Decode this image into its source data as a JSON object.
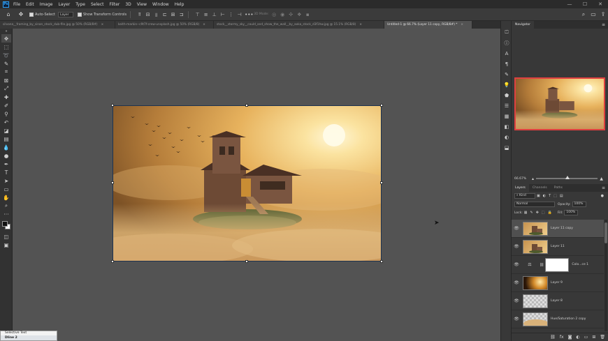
{
  "menubar": {
    "items": [
      "File",
      "Edit",
      "Image",
      "Layer",
      "Type",
      "Select",
      "Filter",
      "3D",
      "View",
      "Window",
      "Help"
    ]
  },
  "options": {
    "auto_select": "Auto-Select",
    "target": "Layer",
    "transform_controls": "Show Transform Controls",
    "mode_3d": "3D Mode:"
  },
  "tabs": [
    {
      "label": "silvana__framing_by_sinan_stock_dub-file.jpg @ 50% (RGB/8#)",
      "active": false
    },
    {
      "label": "keith-markin--c9t7f-crew-unsplash.jpg @ 50% (RGB/8)",
      "active": false
    },
    {
      "label": "stock__stormy_sky__could_and_show_the_wall__by_aoka_stock_d3f1hw.jpg @ 15.1% (RGB/8)",
      "active": false
    },
    {
      "label": "Untitled-1 @ 66.7% (Layer 11 copy, RGB/8#) *",
      "active": true
    }
  ],
  "navigator": {
    "title": "Navigator",
    "zoom": "66.67%"
  },
  "layers_panel": {
    "tabs": [
      "Layers",
      "Channels",
      "Paths"
    ],
    "kind_label": "Kind",
    "blend_mode": "Normal",
    "opacity_label": "Opacity:",
    "opacity_value": "100%",
    "lock_label": "Lock:",
    "fill_label": "Fill:",
    "fill_value": "100%",
    "layers": [
      {
        "name": "Layer 11 copy",
        "thumb": "scene",
        "selected": true
      },
      {
        "name": "Layer 11",
        "thumb": "scene",
        "selected": false
      },
      {
        "name": "Colo...ce 1",
        "thumb": "adjustment",
        "selected": false
      },
      {
        "name": "Layer 9",
        "thumb": "sun",
        "selected": false
      },
      {
        "name": "Layer 8",
        "thumb": "transparent",
        "selected": false
      },
      {
        "name": "Hue/Saturation 2 copy",
        "thumb": "clouds",
        "selected": false
      }
    ]
  },
  "taskbar": {
    "item1": "Selective Text",
    "item2": "Dline 2"
  },
  "colors": {
    "nav_frame": "#e04040",
    "accent": "#31a8ff"
  }
}
